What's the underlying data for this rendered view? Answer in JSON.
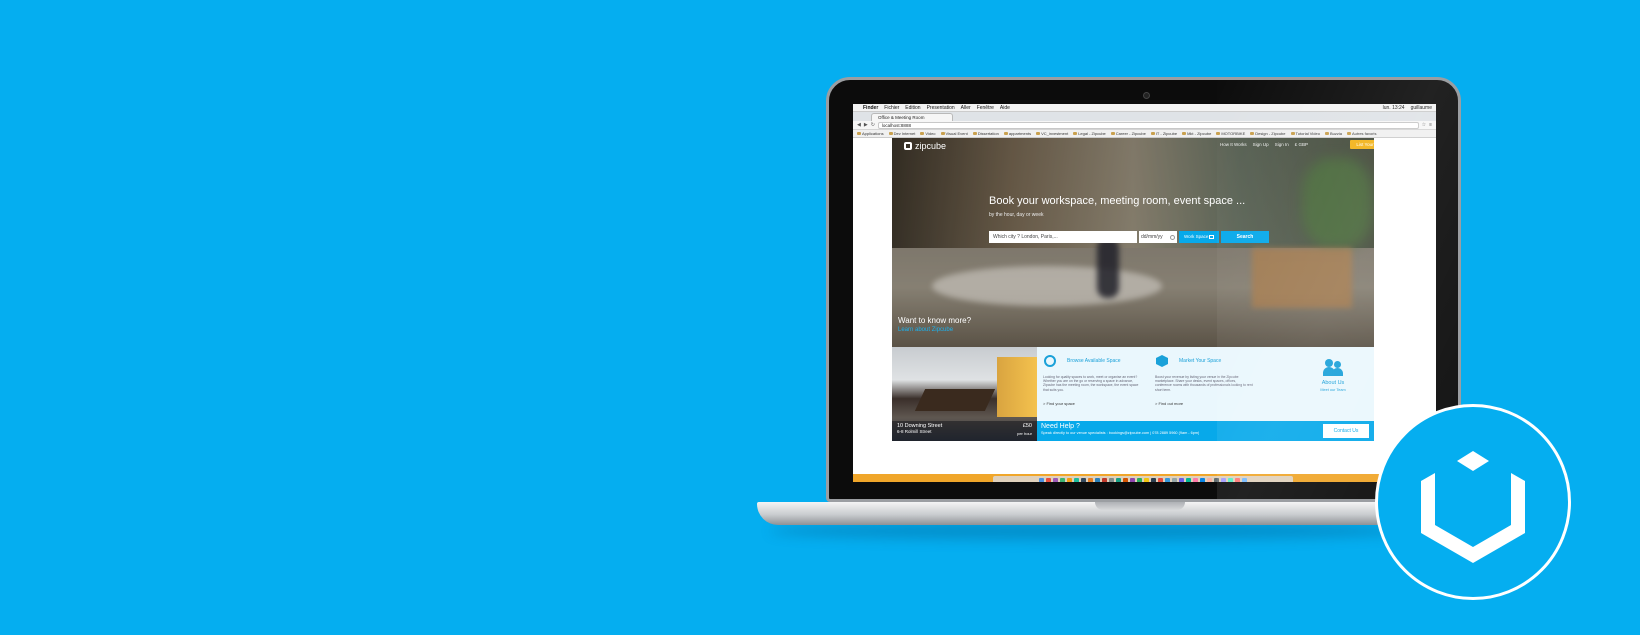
{
  "macbar": {
    "apple": "",
    "app": "Finder",
    "menus": [
      "Fichier",
      "Edition",
      "Presentation",
      "Aller",
      "Fenêtre",
      "Aide"
    ],
    "clock": "lun. 13:24",
    "user": "guillaume"
  },
  "browser": {
    "tab_title": "Office & Meeting Room",
    "url": "localhost:8888",
    "bookmarks": [
      "Applications",
      "Dev Internet",
      "Video",
      "Visual Event",
      "Dissertation",
      "appartments",
      "VC_investment",
      "Legal - Zipcube",
      "Career - Zipcube",
      "IT - Zipcube",
      "Mkt - Zipcube",
      "MOTORBIKE",
      "Design - Zipcube",
      "Tutorial Video",
      "Buzzia",
      "Autres favoris"
    ]
  },
  "site": {
    "logo_text": "zipcube",
    "nav": [
      "How It Works",
      "Sign Up",
      "Sign In",
      "£ GBP"
    ],
    "list_button": "List Your Space",
    "hero_title": "Book your workspace, meeting room, event space ...",
    "hero_subtitle": "by the hour, day or week",
    "city_placeholder": "Which city ? London, Paris,...",
    "date_placeholder": "dd/mm/yy",
    "space_type": "Work Space",
    "search_label": "Search",
    "want_more": "Want to know more?",
    "learn_about": "Learn about Zipcube",
    "venue": {
      "name": "10 Downing Street",
      "address": "6-8 Rolmill Street",
      "price": "£50",
      "per": "per hour"
    },
    "features": [
      {
        "title": "Browse Available Space",
        "desc": "Looking for quality spaces to work, meet or organise an event? Whether you are on the go or reserving a space in advance, Zipcube has the meeting room, the workspace, the event space that suits you.",
        "link": "> Find your space",
        "icon": "magnifier-icon"
      },
      {
        "title": "Market Your Space",
        "desc": "Boost your revenue by listing your venue in the Zipcube marketplace. Share your desks, event spaces, offices, conference rooms with thousands of professionals looking to rent short term.",
        "link": "> Find out more",
        "icon": "cube-icon"
      }
    ],
    "about": {
      "title": "About Us",
      "meet": "Meet our Team",
      "icon": "people-icon"
    },
    "help": {
      "title": "Need Help ?",
      "text": "Speak directly to our venue specialists : bookings@zipcube.com | 078 2889 5960 (9am - 6pm)",
      "contact": "Contact Us"
    }
  },
  "dock_colors": [
    "#4a8fe0",
    "#e94b3c",
    "#9b59b6",
    "#3cb371",
    "#f39c12",
    "#1abc9c",
    "#34495e",
    "#e67e22",
    "#2980b9",
    "#c0392b",
    "#7f8c8d",
    "#16a085",
    "#d35400",
    "#8e44ad",
    "#27ae60",
    "#f1c40f",
    "#2c3e50",
    "#e74c3c",
    "#3498db",
    "#95a5a6",
    "#6c5ce7",
    "#00b894",
    "#fd79a8",
    "#0984e3",
    "#fab1a0",
    "#636e72",
    "#a29bfe",
    "#55efc4",
    "#ff7675",
    "#74b9ff"
  ],
  "brand_color": "#05aef0",
  "badge_icon": "uikit-cube-logo-icon"
}
